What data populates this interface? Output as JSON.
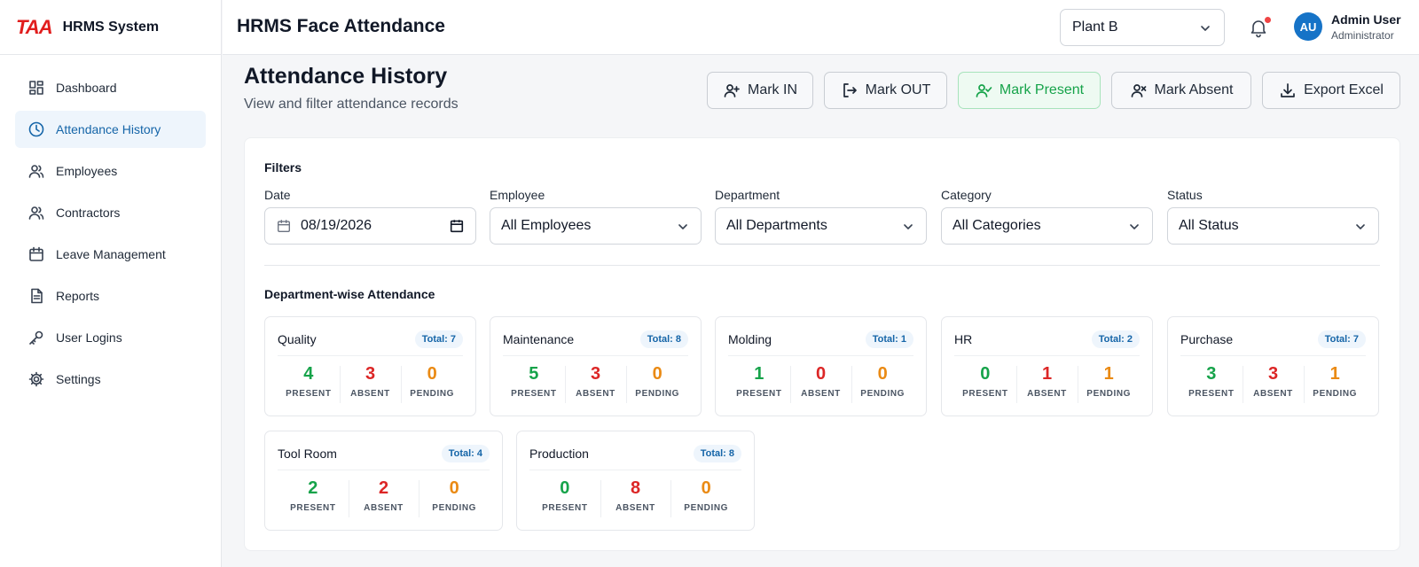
{
  "brand": {
    "logo": "TAA",
    "name": "HRMS System"
  },
  "sidebar": {
    "items": [
      {
        "label": "Dashboard",
        "icon": "dashboard-icon",
        "active": false
      },
      {
        "label": "Attendance History",
        "icon": "clock-icon",
        "active": true
      },
      {
        "label": "Employees",
        "icon": "users-icon",
        "active": false
      },
      {
        "label": "Contractors",
        "icon": "users-icon",
        "active": false
      },
      {
        "label": "Leave Management",
        "icon": "calendar-icon",
        "active": false
      },
      {
        "label": "Reports",
        "icon": "document-icon",
        "active": false
      },
      {
        "label": "User Logins",
        "icon": "key-icon",
        "active": false
      },
      {
        "label": "Settings",
        "icon": "gear-icon",
        "active": false
      }
    ]
  },
  "header": {
    "title": "HRMS Face Attendance",
    "plant": "Plant B",
    "user": {
      "initials": "AU",
      "name": "Admin User",
      "role": "Administrator"
    }
  },
  "page": {
    "title": "Attendance History",
    "subtitle": "View and filter attendance records"
  },
  "actions": {
    "mark_in": "Mark IN",
    "mark_out": "Mark OUT",
    "mark_present": "Mark Present",
    "mark_absent": "Mark Absent",
    "export": "Export Excel"
  },
  "filters": {
    "heading": "Filters",
    "date": {
      "label": "Date",
      "value": "08/19/2026"
    },
    "employee": {
      "label": "Employee",
      "value": "All Employees"
    },
    "department": {
      "label": "Department",
      "value": "All Departments"
    },
    "category": {
      "label": "Category",
      "value": "All Categories"
    },
    "status": {
      "label": "Status",
      "value": "All Status"
    }
  },
  "dept_section": {
    "heading": "Department-wise Attendance",
    "present_label": "PRESENT",
    "absent_label": "ABSENT",
    "pending_label": "PENDING",
    "departments": [
      {
        "name": "Quality",
        "total": "Total: 7",
        "present": "4",
        "absent": "3",
        "pending": "0"
      },
      {
        "name": "Maintenance",
        "total": "Total: 8",
        "present": "5",
        "absent": "3",
        "pending": "0"
      },
      {
        "name": "Molding",
        "total": "Total: 1",
        "present": "1",
        "absent": "0",
        "pending": "0"
      },
      {
        "name": "HR",
        "total": "Total: 2",
        "present": "0",
        "absent": "1",
        "pending": "1"
      },
      {
        "name": "Purchase",
        "total": "Total: 7",
        "present": "3",
        "absent": "3",
        "pending": "1"
      },
      {
        "name": "Tool Room",
        "total": "Total: 4",
        "present": "2",
        "absent": "2",
        "pending": "0"
      },
      {
        "name": "Production",
        "total": "Total: 8",
        "present": "0",
        "absent": "8",
        "pending": "0"
      }
    ]
  },
  "colors": {
    "brand_red": "#e11d1d",
    "accent_blue": "#1565a8",
    "present": "#16a34a",
    "absent": "#dc2626",
    "pending": "#ea8a14"
  }
}
